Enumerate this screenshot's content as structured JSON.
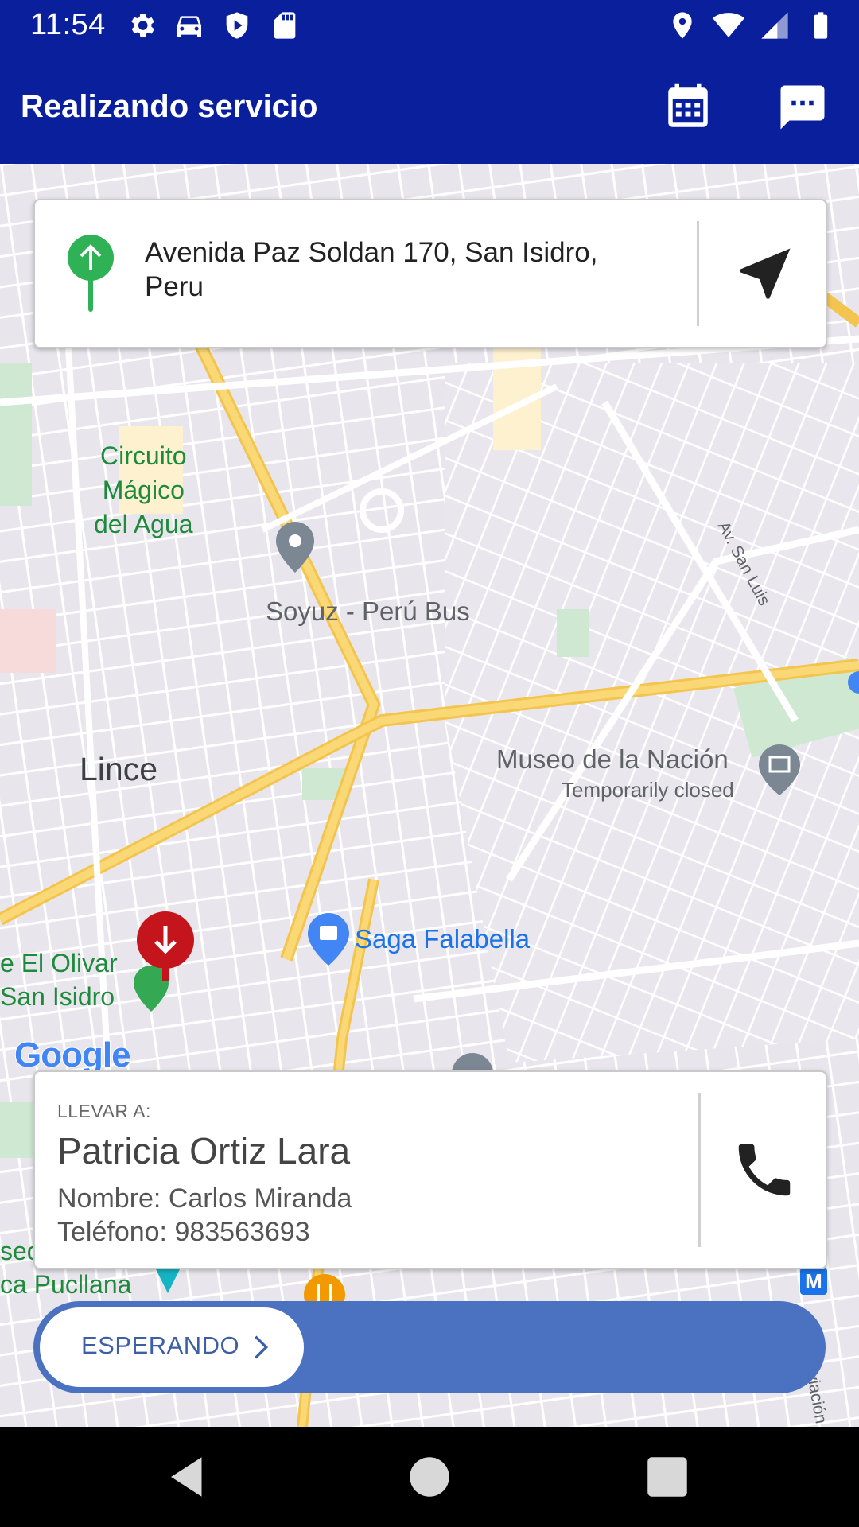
{
  "status_bar": {
    "time": "11:54",
    "left_icons": [
      "settings-icon",
      "car-icon",
      "shield-icon",
      "sd-card-icon"
    ],
    "right_icons": [
      "location-icon",
      "wifi-icon",
      "signal-icon",
      "battery-icon"
    ]
  },
  "app_bar": {
    "title": "Realizando servicio",
    "actions": [
      "calendar-icon",
      "chat-icon"
    ],
    "color": "#0a1f9c"
  },
  "map": {
    "labels": {
      "circuito_1": "Circuito",
      "circuito_2": "Mágico",
      "circuito_3": "del Agua",
      "soyuz": "Soyuz - Perú Bus",
      "lince": "Lince",
      "museo": "Museo de la Nación",
      "museo_status": "Temporarily closed",
      "saga": "Saga Falabella",
      "olivar_1": "e El Olivar",
      "olivar_2": "San Isidro",
      "pucllana_1": "seo",
      "pucllana_2": "ca Pucllana",
      "san_luis": "Av. San Luis",
      "aviacion": "Aviación",
      "metro": "M"
    },
    "attribution": "Google"
  },
  "origin": {
    "address": "Avenida Paz Soldan 170, San Isidro, Peru",
    "pin_color": "#2fb155"
  },
  "destination": {
    "header": "LLEVAR A:",
    "recipient": "Patricia Ortiz Lara",
    "contact_name": "Nombre: Carlos Miranda",
    "contact_phone": "Teléfono: 983563693",
    "pin_color": "#c4141c"
  },
  "action_slider": {
    "label": "ESPERANDO",
    "color": "#4a72c0"
  },
  "nav_bar": {
    "buttons": [
      "back-icon",
      "home-icon",
      "recents-icon"
    ]
  }
}
